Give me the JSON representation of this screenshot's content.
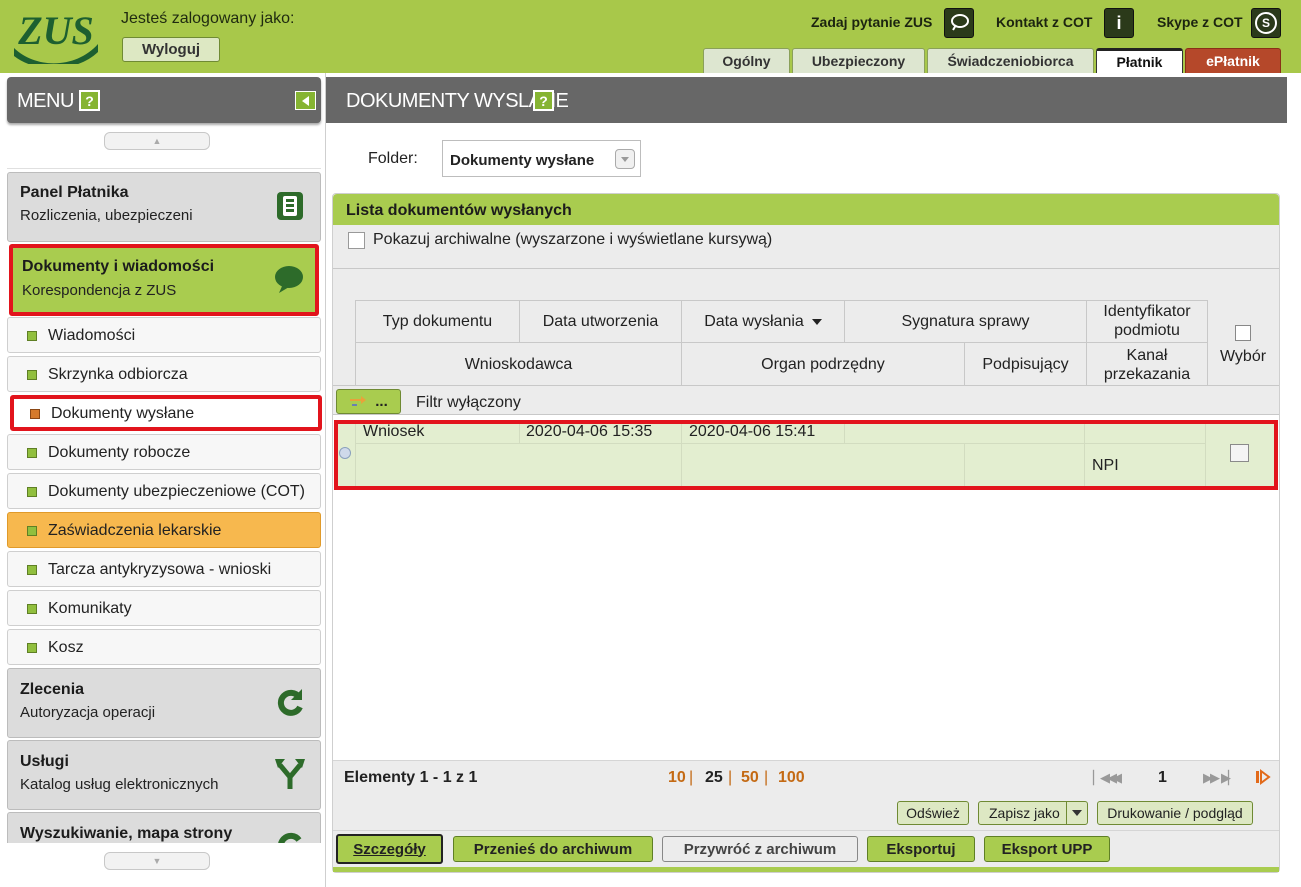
{
  "header": {
    "logo_text": "ZUS",
    "logged_as": "Jesteś zalogowany jako:",
    "logout_label": "Wyloguj",
    "ask_zus": "Zadaj pytanie ZUS",
    "contact_cot": "Kontakt z COT",
    "skype_cot": "Skype z COT",
    "contact_icon_glyph": "i",
    "skype_icon_glyph": "S",
    "tabs": [
      {
        "label": "Ogólny"
      },
      {
        "label": "Ubezpieczony"
      },
      {
        "label": "Świadczeniobiorca"
      },
      {
        "label": "Płatnik"
      },
      {
        "label": "ePłatnik"
      }
    ]
  },
  "sidebar": {
    "title": "MENU",
    "help_glyph": "?",
    "sections": [
      {
        "title": "Panel Płatnika",
        "subtitle": "Rozliczenia, ubezpieczeni"
      },
      {
        "title": "Dokumenty i wiadomości",
        "subtitle": "Korespondencja z ZUS"
      },
      {
        "title": "Zlecenia",
        "subtitle": "Autoryzacja operacji"
      },
      {
        "title": "Usługi",
        "subtitle": "Katalog usług elektronicznych"
      },
      {
        "title": "Wyszukiwanie, mapa strony",
        "subtitle": ""
      }
    ],
    "items": [
      {
        "label": "Wiadomości"
      },
      {
        "label": "Skrzynka odbiorcza"
      },
      {
        "label": "Dokumenty wysłane"
      },
      {
        "label": "Dokumenty robocze"
      },
      {
        "label": "Dokumenty ubezpieczeniowe (COT)"
      },
      {
        "label": "Zaświadczenia lekarskie"
      },
      {
        "label": "Tarcza antykryzysowa - wnioski"
      },
      {
        "label": "Komunikaty"
      },
      {
        "label": "Kosz"
      }
    ]
  },
  "main": {
    "title": "DOKUMENTY WYSLANE",
    "help_glyph": "?",
    "folder_label": "Folder:",
    "folder_value": "Dokumenty wysłane",
    "list_title": "Lista dokumentów wysłanych",
    "archive_label": "Pokazuj archiwalne (wyszarzone i wyświetlane kursywą)",
    "columns": {
      "doc_type": "Typ dokumentu",
      "created": "Data utworzenia",
      "sent": "Data wysłania",
      "case_sig": "Sygnatura sprawy",
      "subject_id_1": "Identyfikator",
      "subject_id_2": "podmiotu",
      "applicant": "Wnioskodawca",
      "sub_organ": "Organ podrzędny",
      "signer": "Podpisujący",
      "channel_1": "Kanał",
      "channel_2": "przekazania",
      "select": "Wybór"
    },
    "filter_button": "...",
    "filter_label": "Filtr wyłączony",
    "rows": [
      {
        "doc_type": "Wniosek",
        "created": "2020-04-06 15:35",
        "sent": "2020-04-06 15:41",
        "channel": "NPI"
      }
    ],
    "pager": {
      "items": "Elementy 1 - 1 z 1",
      "sizes": [
        "10",
        "25",
        "50",
        "100"
      ],
      "current_size": "25",
      "page": "1"
    },
    "actions": {
      "refresh": "Odśwież",
      "save_as": "Zapisz jako",
      "print": "Drukowanie / podgląd",
      "details": "Szczegóły",
      "to_archive": "Przenieś do archiwum",
      "from_archive": "Przywróć z archiwum",
      "export": "Eksportuj",
      "export_upp": "Eksport UPP"
    }
  },
  "colors": {
    "brand_green": "#a9cc4f",
    "header_gray": "#676767",
    "highlight_red": "#e2141c",
    "active_orange": "#f7b84e"
  }
}
